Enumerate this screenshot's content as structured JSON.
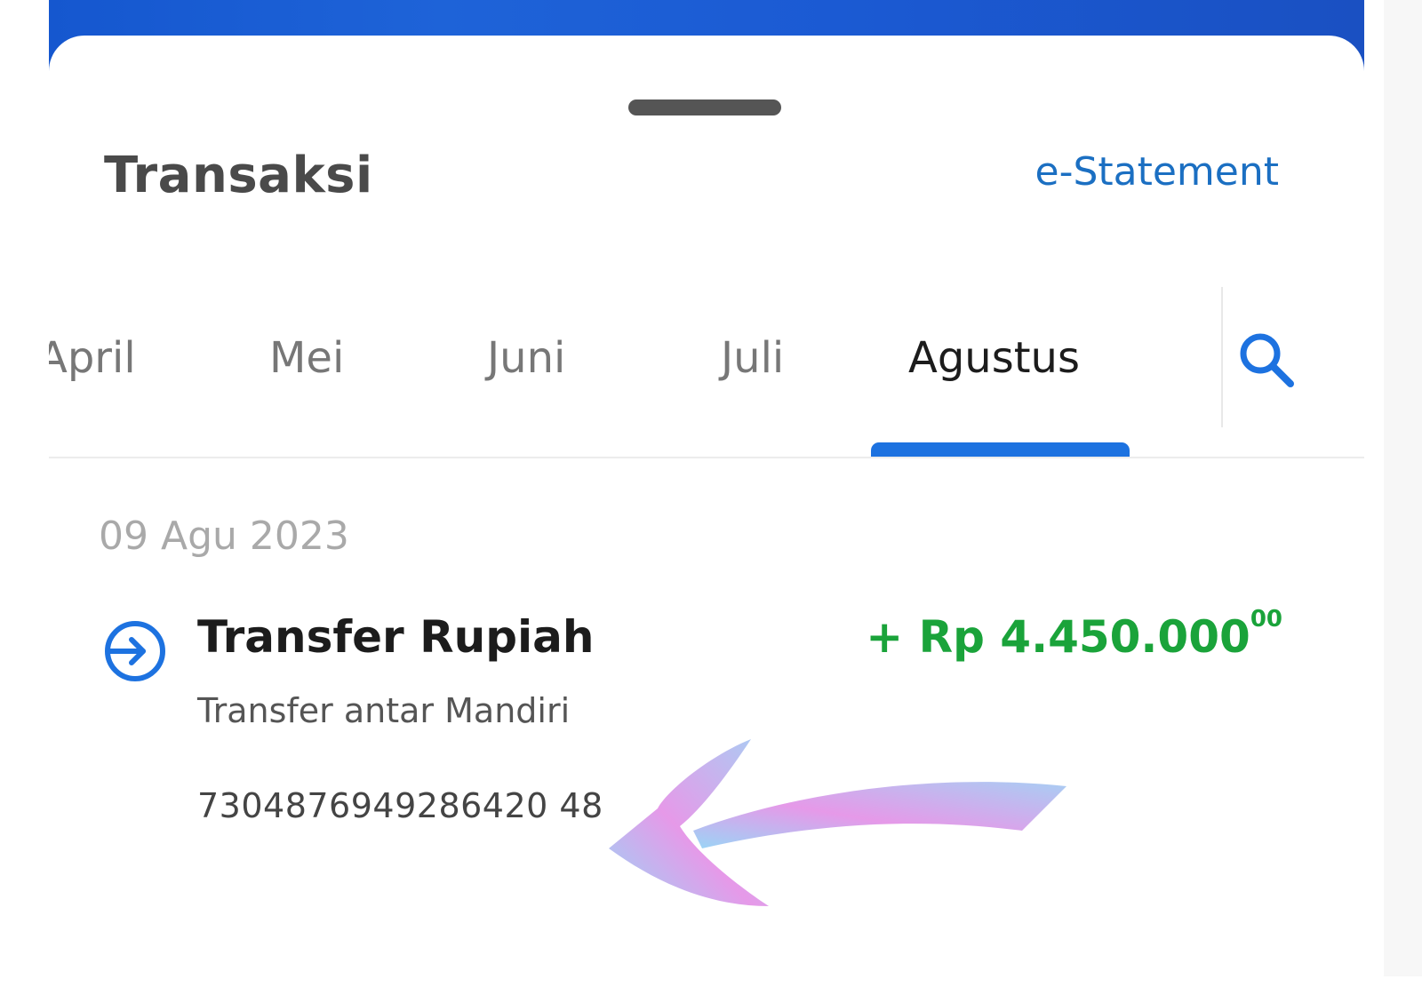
{
  "header": {
    "title": "Transaksi",
    "estatement_label": "e-Statement"
  },
  "tabs": [
    {
      "label": "April",
      "active": false
    },
    {
      "label": "Mei",
      "active": false
    },
    {
      "label": "Juni",
      "active": false
    },
    {
      "label": "Juli",
      "active": false
    },
    {
      "label": "Agustus",
      "active": true
    }
  ],
  "search_icon": "search-icon",
  "transactions": [
    {
      "date": "09 Agu 2023",
      "title": "Transfer Rupiah",
      "amount_main": "+ Rp 4.450.000",
      "amount_cents": "00",
      "description": "Transfer antar Mandiri",
      "reference": "7304876949286420 48",
      "icon": "incoming-transfer-icon"
    }
  ],
  "colors": {
    "brand_blue": "#1557cf",
    "accent_blue": "#1d72e0",
    "link_blue": "#1b6fc2",
    "credit_green": "#1aa33a"
  }
}
